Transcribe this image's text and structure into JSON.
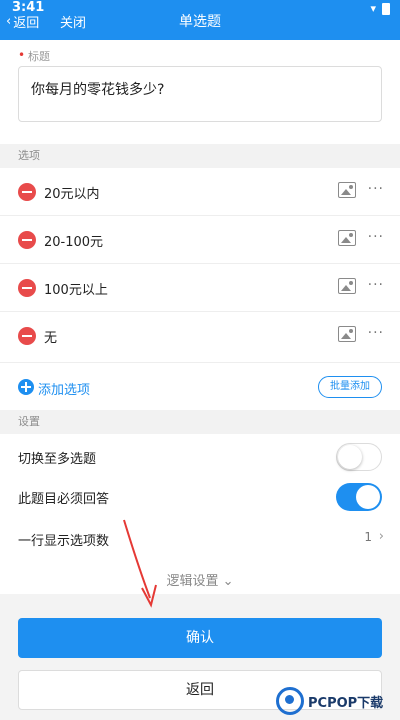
{
  "status_bar": {
    "time": "3:41"
  },
  "nav": {
    "back_label": "返回",
    "close_label": "关闭",
    "title": "单选题"
  },
  "title_section": {
    "label": "标题",
    "value": "你每月的零花钱多少?"
  },
  "options_section": {
    "header": "选项",
    "items": [
      {
        "text": "20元以内"
      },
      {
        "text": "20-100元"
      },
      {
        "text": "100元以上"
      },
      {
        "text": "无"
      }
    ],
    "add_label": "添加选项",
    "batch_label": "批量添加"
  },
  "settings_section": {
    "header": "设置",
    "switch_multi": {
      "label": "切换至多选题",
      "on": false
    },
    "required": {
      "label": "此题目必须回答",
      "on": true
    },
    "per_row": {
      "label": "一行显示选项数",
      "value": "1"
    },
    "logic_label": "逻辑设置"
  },
  "buttons": {
    "confirm": "确认",
    "back": "返回"
  },
  "watermark": {
    "text": "PCPOP下载"
  },
  "colors": {
    "primary": "#1e8ff0",
    "danger": "#e84b4b",
    "arrow": "#e53935"
  }
}
